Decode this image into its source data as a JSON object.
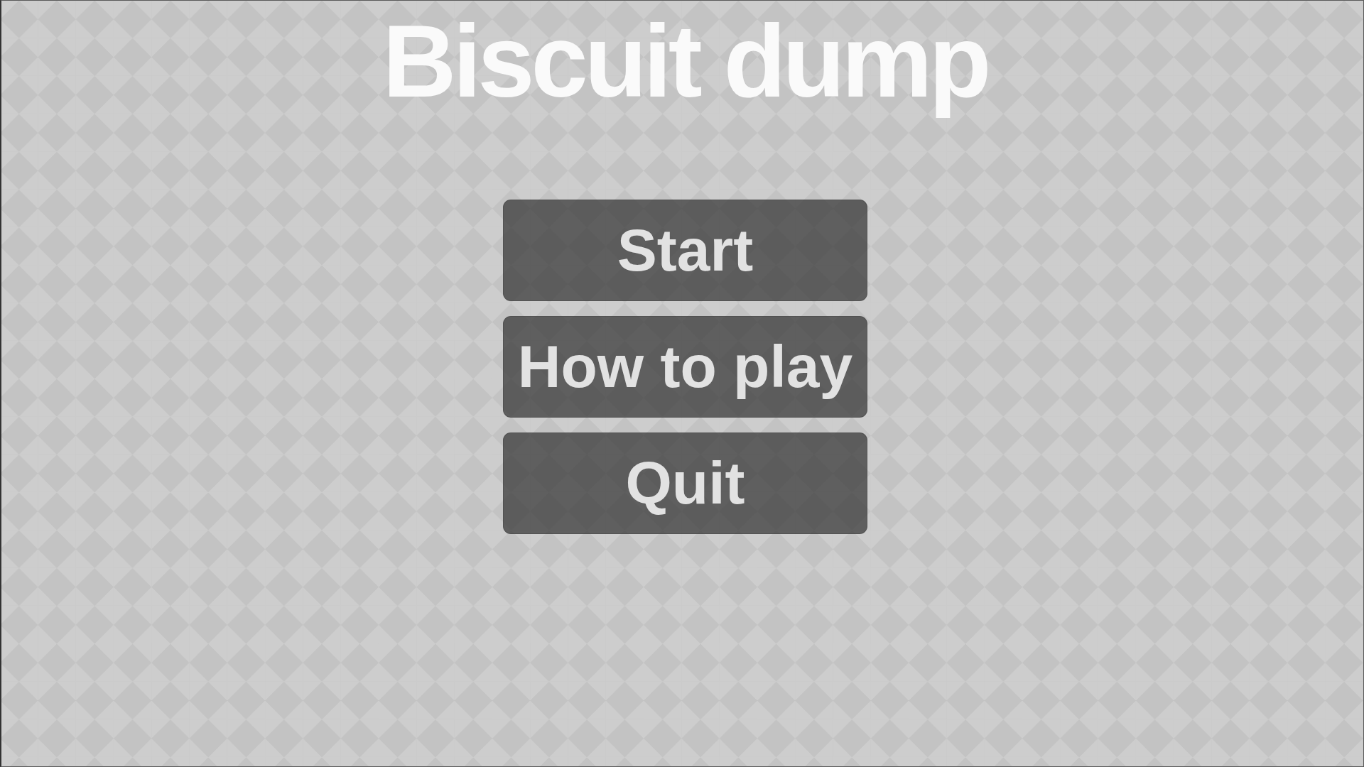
{
  "title": "Biscuit dump",
  "menu": [
    {
      "label": "Start"
    },
    {
      "label": "How to play"
    },
    {
      "label": "Quit"
    }
  ]
}
